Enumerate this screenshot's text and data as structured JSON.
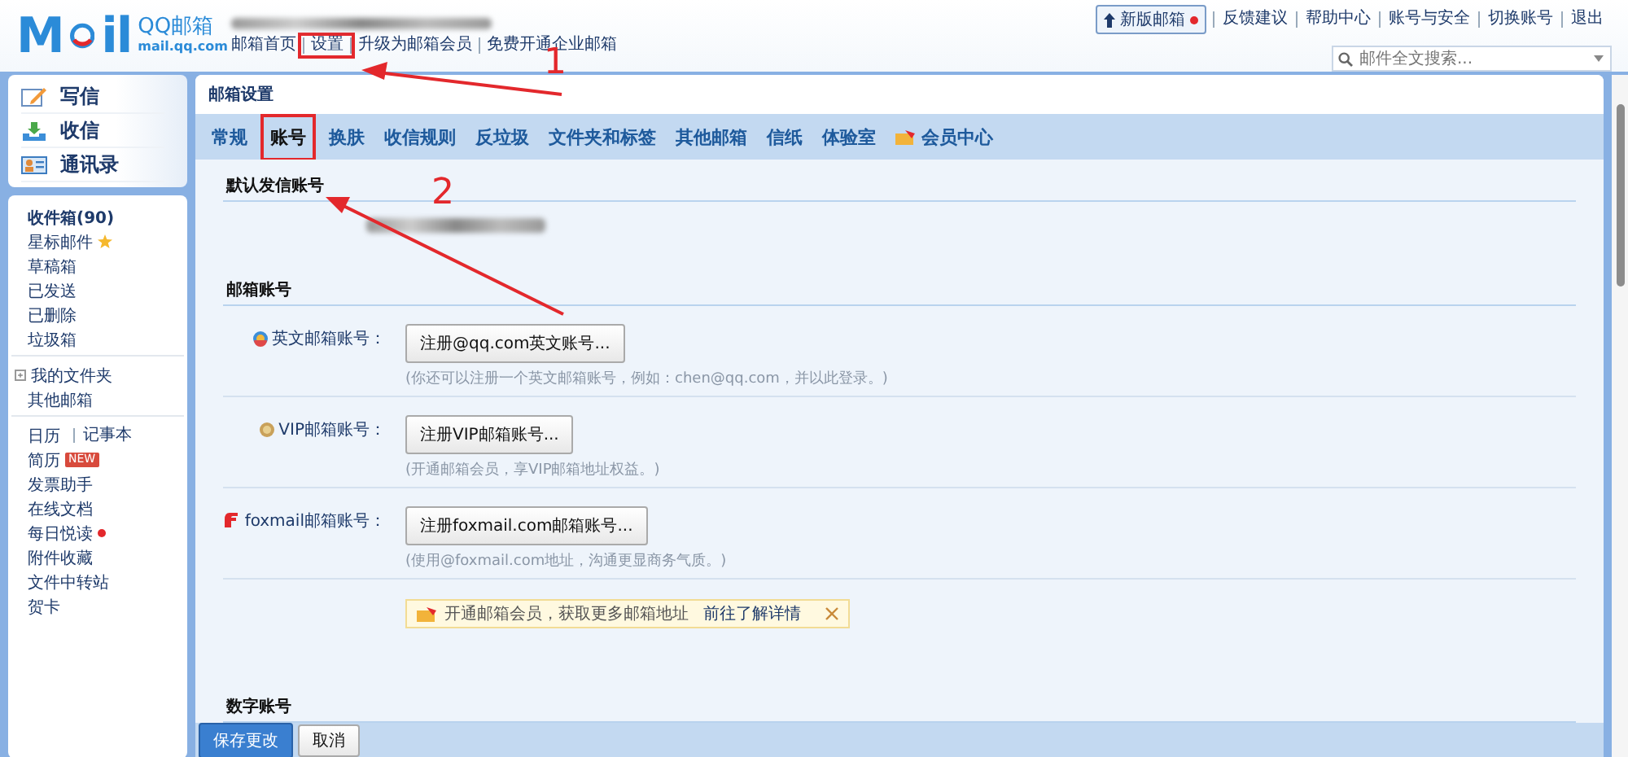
{
  "header": {
    "logo": {
      "left": "M",
      "right": "il",
      "name": "QQ邮箱",
      "domain": "mail.qq.com"
    },
    "nav": [
      {
        "label": "邮箱首页",
        "highlighted": false
      },
      {
        "label": "设置",
        "highlighted": true
      },
      {
        "label": "升级为邮箱会员",
        "highlighted": false
      },
      {
        "label": "免费开通企业邮箱",
        "highlighted": false
      }
    ],
    "new_version_button": {
      "label": "新版邮箱"
    },
    "links": [
      "反馈建议",
      "帮助中心",
      "账号与安全",
      "切换账号",
      "退出"
    ],
    "search": {
      "placeholder": "邮件全文搜索..."
    }
  },
  "sidebar": {
    "actions": [
      {
        "label": "写信",
        "kind": "compose"
      },
      {
        "label": "收信",
        "kind": "receive"
      },
      {
        "label": "通讯录",
        "kind": "contacts"
      }
    ],
    "folders": [
      {
        "label": "收件箱(90)",
        "bold": true,
        "starred": false
      },
      {
        "label": "星标邮件",
        "bold": false,
        "starred": true
      },
      {
        "label": "草稿箱",
        "bold": false,
        "starred": false
      },
      {
        "label": "已发送",
        "bold": false,
        "starred": false
      },
      {
        "label": "已删除",
        "bold": false,
        "starred": false
      },
      {
        "label": "垃圾箱",
        "bold": false,
        "starred": false
      }
    ],
    "my_folders": {
      "label": "我的文件夹",
      "expanded": false
    },
    "other": "其他邮箱",
    "apps_links": [
      "日历",
      "记事本"
    ],
    "apps": [
      {
        "label": "简历",
        "tag": "NEW",
        "dot": false
      },
      {
        "label": "发票助手",
        "dot": false
      },
      {
        "label": "在线文档",
        "dot": false
      },
      {
        "label": "每日悦读",
        "dot": true
      },
      {
        "label": "附件收藏",
        "dot": false
      },
      {
        "label": "文件中转站",
        "dot": false
      },
      {
        "label": "贺卡",
        "dot": false
      }
    ]
  },
  "settings": {
    "title": "邮箱设置",
    "tabs": [
      {
        "label": "常规",
        "selected": false,
        "highlighted": false
      },
      {
        "label": "账号",
        "selected": true,
        "highlighted": true
      },
      {
        "label": "换肤",
        "selected": false,
        "highlighted": false
      },
      {
        "label": "收信规则",
        "selected": false,
        "highlighted": false
      },
      {
        "label": "反垃圾",
        "selected": false,
        "highlighted": false
      },
      {
        "label": "文件夹和标签",
        "selected": false,
        "highlighted": false
      },
      {
        "label": "其他邮箱",
        "selected": false,
        "highlighted": false
      },
      {
        "label": "信纸",
        "selected": false,
        "highlighted": false
      },
      {
        "label": "体验室",
        "selected": false,
        "highlighted": false
      },
      {
        "label": "会员中心",
        "selected": false,
        "highlighted": false,
        "kind": "vip"
      }
    ],
    "default_sender": {
      "heading": "默认发信账号"
    },
    "mail_accounts": {
      "heading": "邮箱账号",
      "rows": [
        {
          "kind": "globe",
          "label": "英文邮箱账号：",
          "button": "注册@qq.com英文账号...",
          "hint": "(你还可以注册一个英文邮箱账号，例如：chen@qq.com，并以此登录。)"
        },
        {
          "kind": "coin",
          "label": "VIP邮箱账号：",
          "button": "注册VIP邮箱账号...",
          "hint": "(开通邮箱会员，享VIP邮箱地址权益。)"
        },
        {
          "kind": "foxmail",
          "label": "foxmail邮箱账号：",
          "button": "注册foxmail.com邮箱账号...",
          "hint": "(使用@foxmail.com地址，沟通更显商务气质。)"
        }
      ],
      "notice": {
        "text": "开通邮箱会员，获取更多邮箱地址",
        "link": "前往了解详情"
      }
    },
    "digital_account": {
      "heading": "数字账号"
    },
    "footer": {
      "save": "保存更改",
      "cancel": "取消"
    }
  },
  "annotations": [
    "1",
    "2"
  ]
}
